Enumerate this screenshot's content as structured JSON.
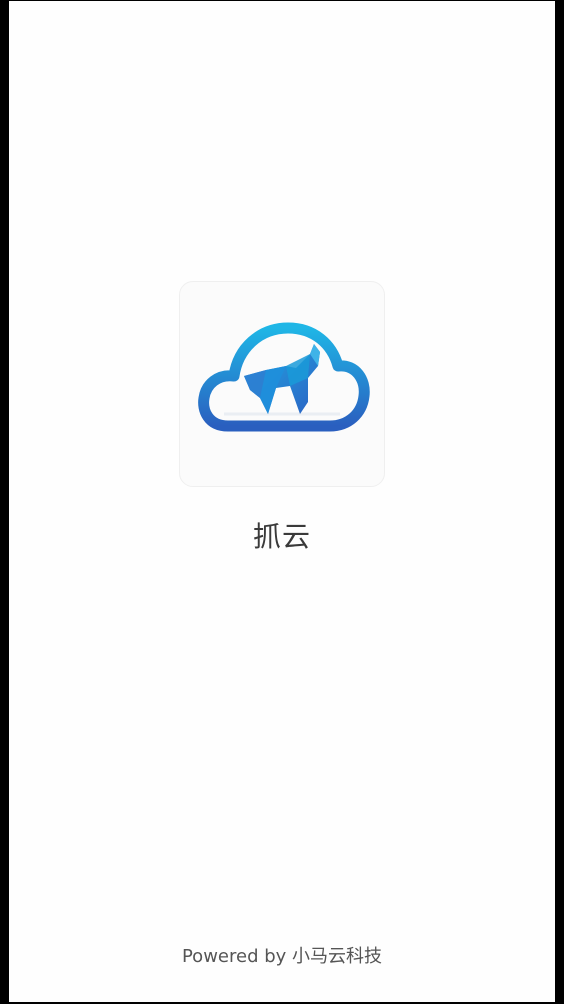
{
  "splash": {
    "app_name": "抓云",
    "footer": "Powered by 小马云科技",
    "icon": "cloud-horse-logo-icon"
  },
  "colors": {
    "background": "#fefefe",
    "logo_blue_light": "#1fb6e6",
    "logo_blue_dark": "#2a5fbf",
    "text": "#3a3a3a",
    "footer_text": "#555555"
  }
}
